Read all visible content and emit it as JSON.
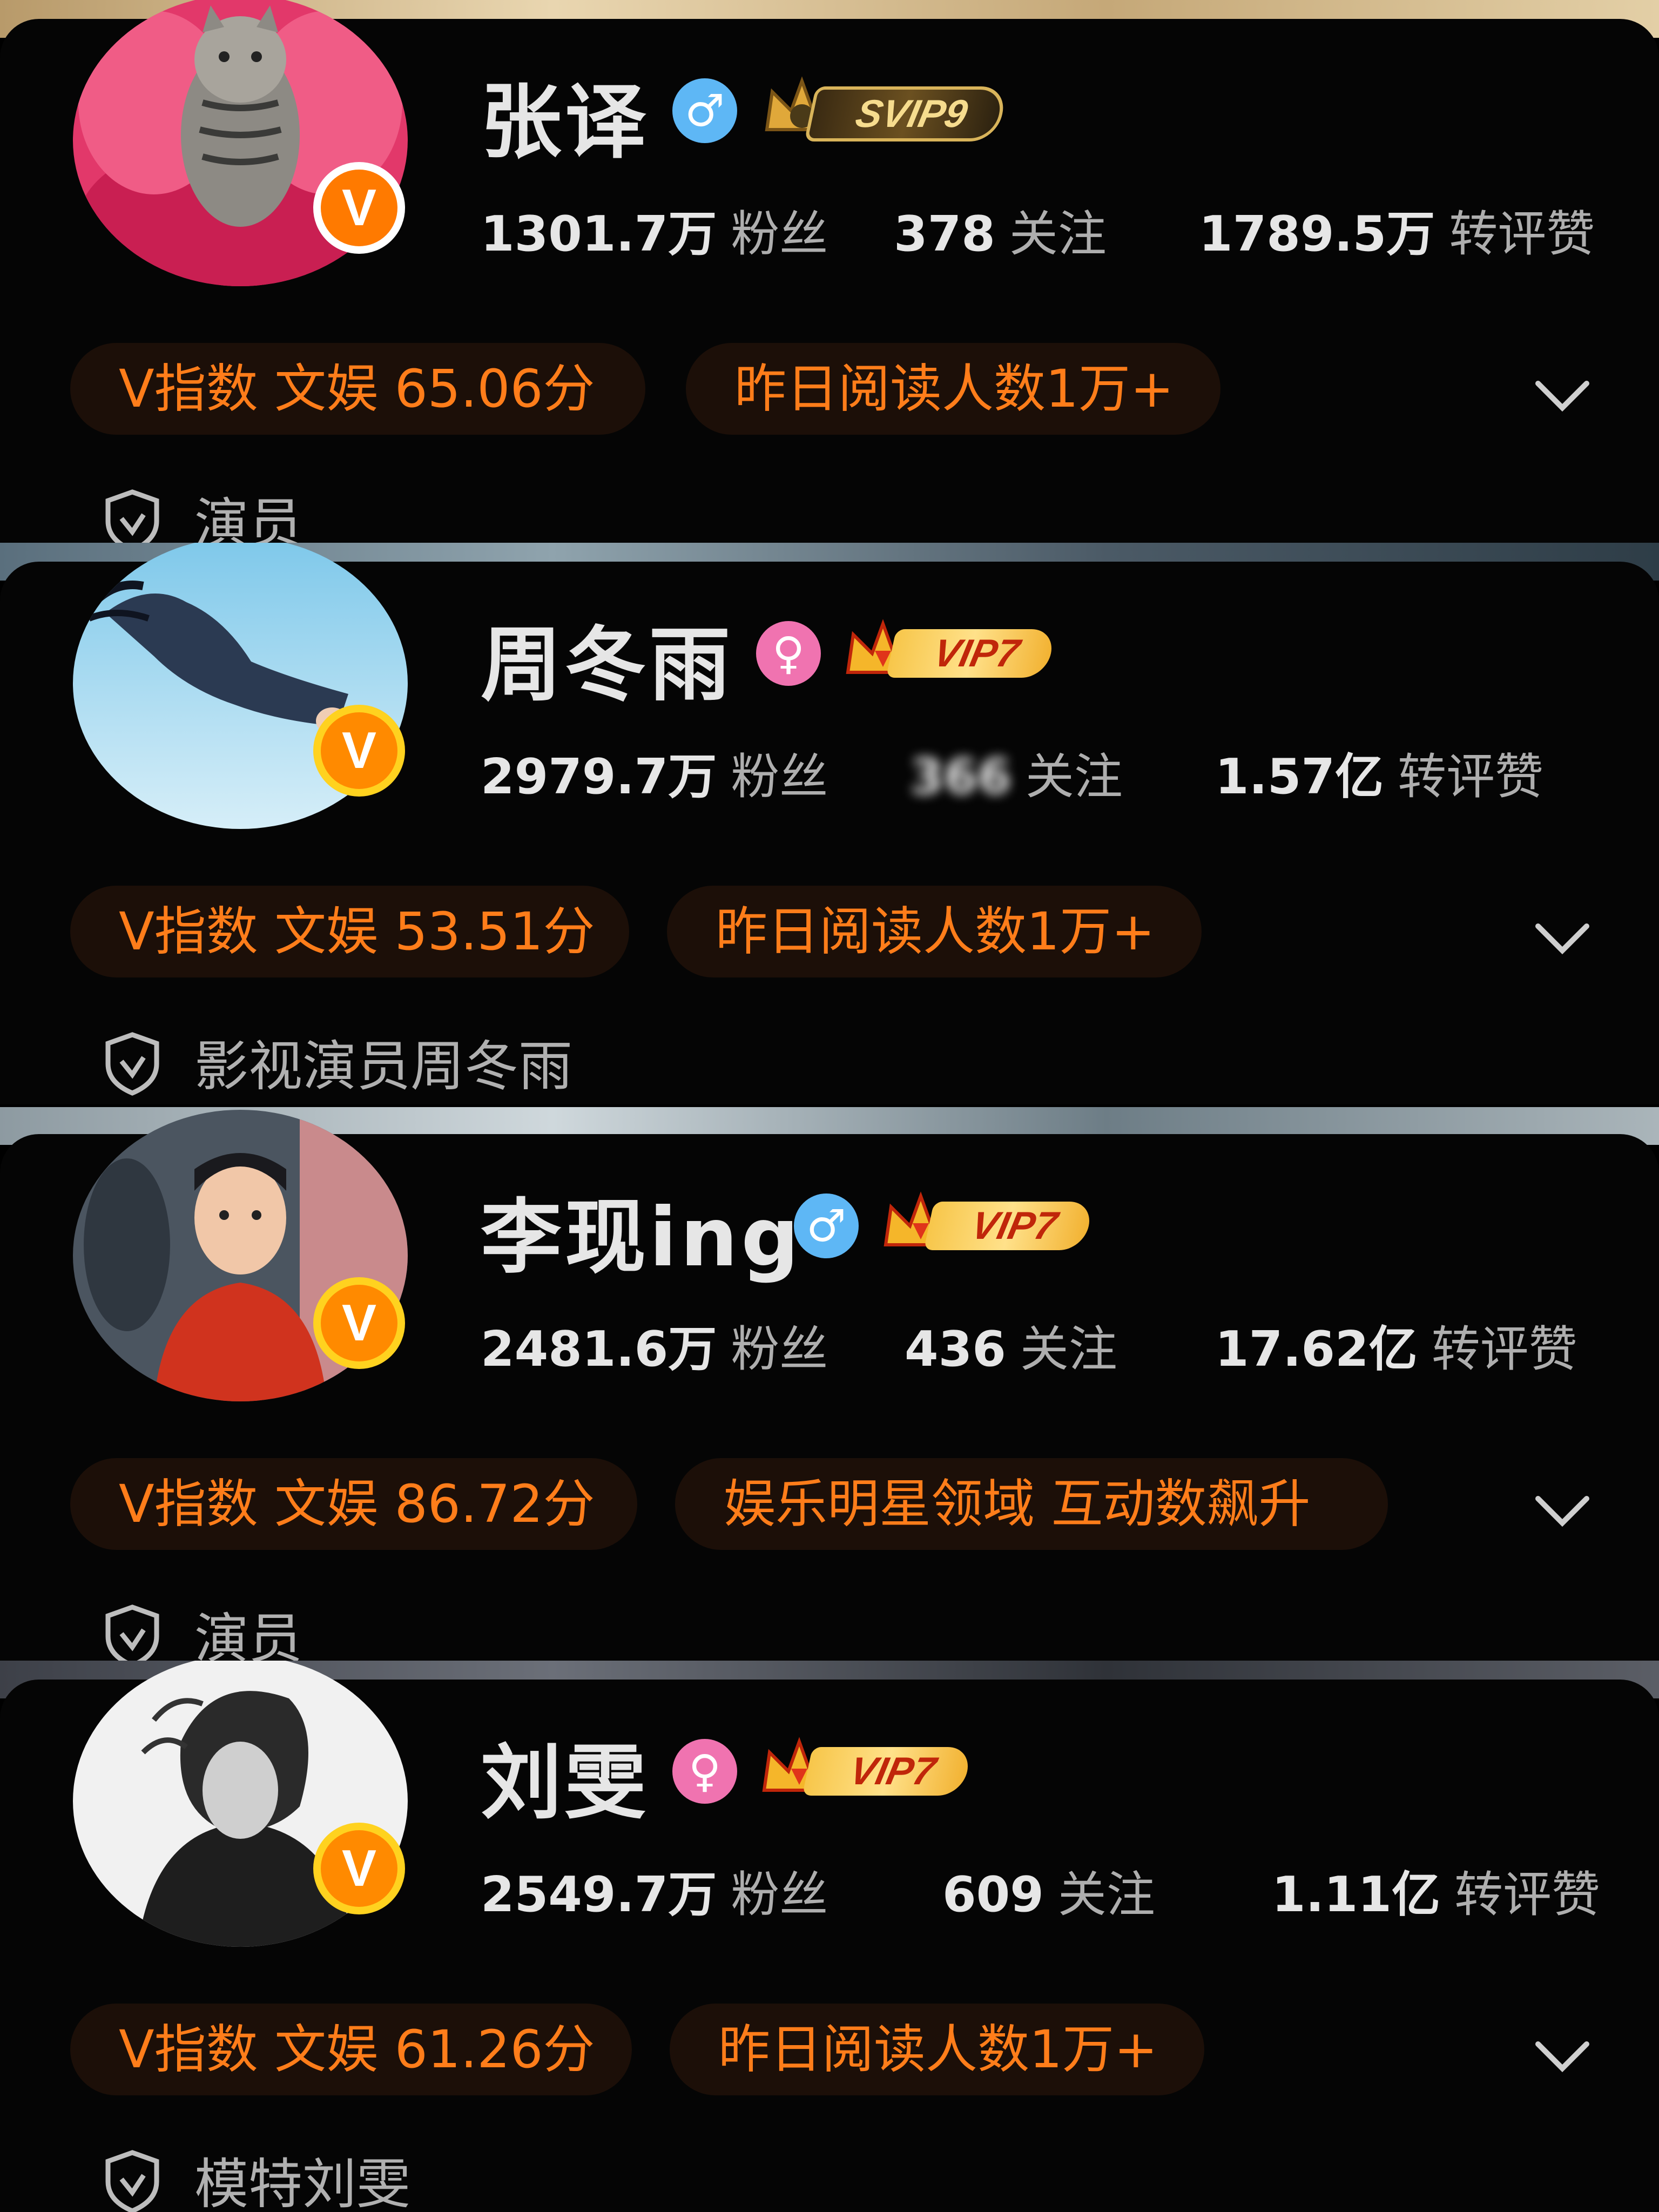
{
  "profiles": [
    {
      "name": "张译",
      "gender": "male",
      "gender_symbol": "♂",
      "vip_label": "SVIP9",
      "vip_type": "svip",
      "fans_value": "1301.7万",
      "fans_label": "粉丝",
      "follow_value": "378",
      "follow_label": "关注",
      "interact_value": "1789.5万",
      "interact_label": "转评赞",
      "pill_1": "V指数 文娱 65.06分",
      "pill_2": "昨日阅读人数1万+",
      "verification": "演员",
      "avatar_icon": "cat-avatar",
      "badge_letter": "V"
    },
    {
      "name": "周冬雨",
      "gender": "female",
      "gender_symbol": "♀",
      "vip_label": "VIP7",
      "vip_type": "vip",
      "fans_value": "2979.7万",
      "fans_label": "粉丝",
      "follow_value": "366",
      "follow_label": "关注",
      "interact_value": "1.57亿",
      "interact_label": "转评赞",
      "pill_1": "V指数 文娱 53.51分",
      "pill_2": "昨日阅读人数1万+",
      "verification": "影视演员周冬雨",
      "avatar_icon": "underwater-avatar",
      "badge_letter": "V"
    },
    {
      "name": "李现ing",
      "gender": "male",
      "gender_symbol": "♂",
      "vip_label": "VIP7",
      "vip_type": "vip",
      "fans_value": "2481.6万",
      "fans_label": "粉丝",
      "follow_value": "436",
      "follow_label": "关注",
      "interact_value": "17.62亿",
      "interact_label": "转评赞",
      "pill_1": "V指数 文娱 86.72分",
      "pill_2": "娱乐明星领域 互动数飙升",
      "verification": "演员",
      "avatar_icon": "costume-portrait-avatar",
      "badge_letter": "V"
    },
    {
      "name": "刘雯",
      "gender": "female",
      "gender_symbol": "♀",
      "vip_label": "VIP7",
      "vip_type": "vip",
      "fans_value": "2549.7万",
      "fans_label": "粉丝",
      "follow_value": "609",
      "follow_label": "关注",
      "interact_value": "1.11亿",
      "interact_label": "转评赞",
      "pill_1": "V指数 文娱 61.26分",
      "pill_2": "昨日阅读人数1万+",
      "verification": "模特刘雯",
      "avatar_icon": "bw-portrait-avatar",
      "badge_letter": "V"
    }
  ],
  "colors": {
    "accent_orange": "#ff7d1a",
    "pill_bg": "#1c0f08",
    "male_blue": "#5eb7f5",
    "female_pink": "#f073b0",
    "vip_gold": "#f7c64a"
  }
}
